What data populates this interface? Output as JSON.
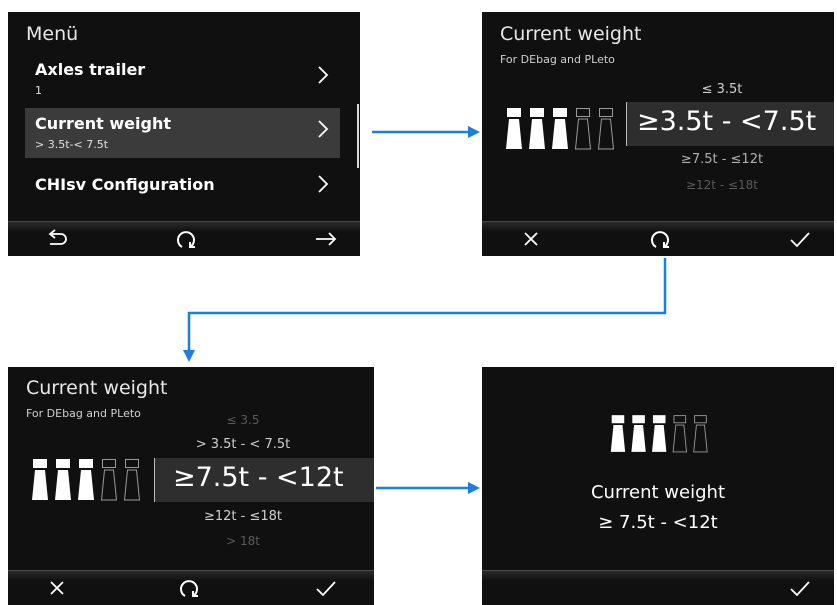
{
  "colors": {
    "screen_bg": "#101010",
    "selected_bg": "#3b3b3b",
    "arrow": "#1a7fe0",
    "text_primary": "#ffffff",
    "text_dim": "#8a8a8a",
    "text_faint": "#5a5a5a"
  },
  "screen1": {
    "title": "Menü",
    "items": [
      {
        "label": "Axles trailer",
        "sub": "1"
      },
      {
        "label": "Current weight",
        "sub": "> 3.5t-< 7.5t"
      },
      {
        "label": "CHIsv Configuration"
      }
    ],
    "bottom": {
      "left_icon": "back-icon",
      "center_icon": "rotate-icon",
      "right_icon": "forward-arrow-icon"
    }
  },
  "screen2": {
    "title": "Current weight",
    "subtitle": "For DEbag and PLeto",
    "option_above": "≤ 3.5t",
    "selected": "≥3.5t - <7.5t",
    "option_below1": "≥7.5t - ≤12t",
    "option_below2": "≥12t - ≤18t",
    "axle_level": 3,
    "bottom": {
      "left_icon": "cancel-icon",
      "center_icon": "rotate-icon",
      "right_icon": "check-icon"
    }
  },
  "screen3": {
    "title": "Current weight",
    "subtitle": "For DEbag and PLeto",
    "option_above2": "≤ 3.5",
    "option_above1": "> 3.5t - < 7.5t",
    "selected": "≥7.5t - <12t",
    "option_below1": "≥12t - ≤18t",
    "option_below2": "> 18t",
    "axle_level": 3,
    "bottom": {
      "left_icon": "cancel-icon",
      "center_icon": "rotate-icon",
      "right_icon": "check-icon"
    }
  },
  "screen4": {
    "title": "Current weight",
    "value": "≥ 7.5t - <12t",
    "axle_level": 3,
    "bottom": {
      "right_icon": "check-icon"
    }
  }
}
